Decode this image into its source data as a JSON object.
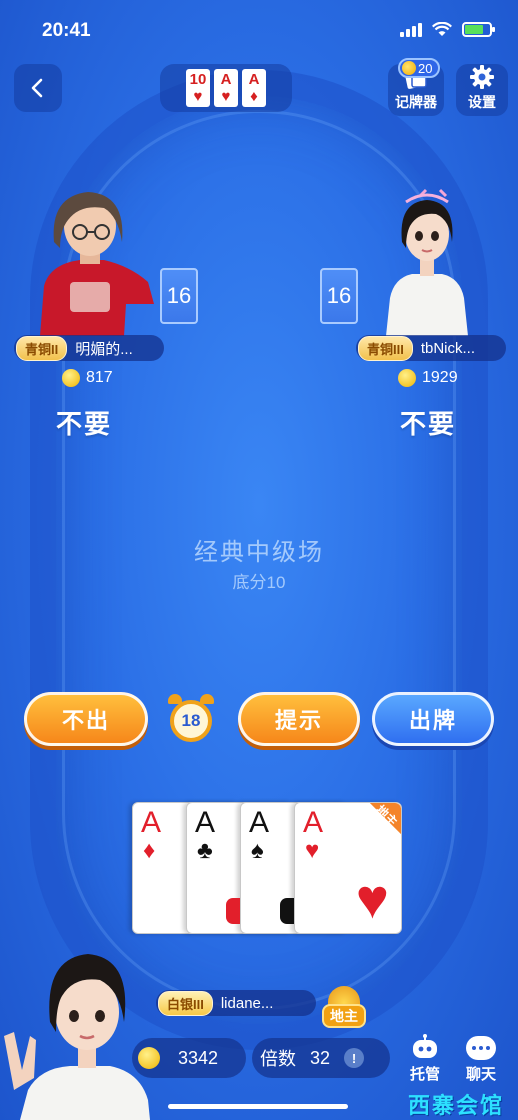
{
  "status_bar": {
    "time": "20:41"
  },
  "recent_play": {
    "cards": [
      {
        "rank": "10",
        "suit": "♥"
      },
      {
        "rank": "A",
        "suit": "♥"
      },
      {
        "rank": "A",
        "suit": "♦"
      }
    ]
  },
  "top_right": {
    "card_counter_label": "记牌器",
    "card_counter_badge": "20",
    "settings_label": "设置"
  },
  "players": {
    "left": {
      "rank": "青铜II",
      "name": "明媚的...",
      "beans": "817",
      "cards_left": "16",
      "status": "不要"
    },
    "right": {
      "rank": "青铜III",
      "name": "tbNick...",
      "beans": "1929",
      "cards_left": "16",
      "status": "不要"
    },
    "self": {
      "rank": "白银III",
      "name": "lidane...",
      "beans": "3342",
      "role_badge": "地主"
    }
  },
  "room": {
    "title": "经典中级场",
    "base_score": "底分10"
  },
  "actions": {
    "pass": "不出",
    "timer": "18",
    "hint": "提示",
    "play": "出牌"
  },
  "hand": [
    {
      "rank": "A",
      "suit": "♦",
      "color": "red"
    },
    {
      "rank": "A",
      "suit": "♣",
      "color": "black"
    },
    {
      "rank": "A",
      "suit": "♠",
      "color": "black"
    },
    {
      "rank": "A",
      "suit": "♥",
      "color": "red",
      "landlord_mark": "地主"
    }
  ],
  "bottom": {
    "multiplier_label": "倍数",
    "multiplier_value": "32",
    "info_icon": "!",
    "auto_label": "托管",
    "chat_label": "聊天"
  },
  "watermark": "西寨会馆"
}
